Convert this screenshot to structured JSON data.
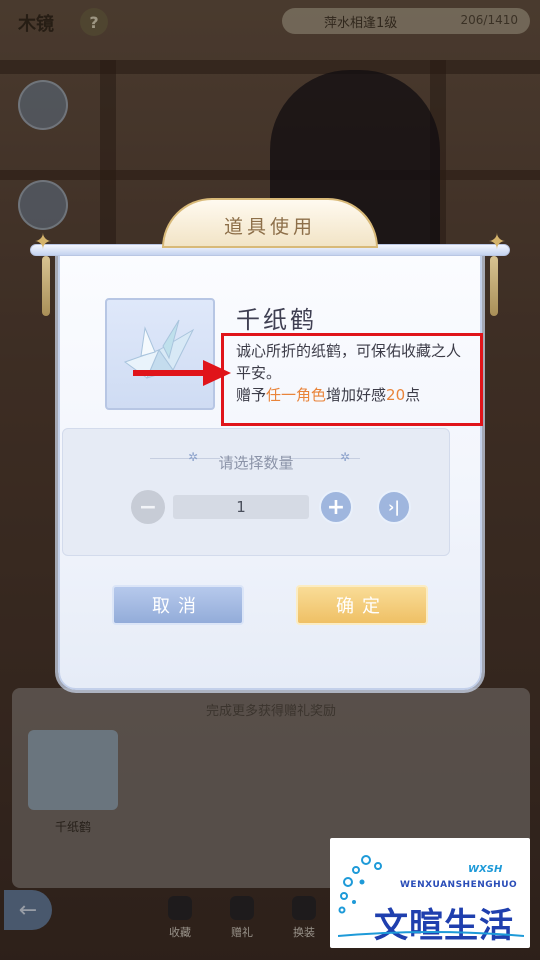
{
  "top_bar": {
    "title": "木镜",
    "help_label": "?",
    "level_label": "萍水相逢1级",
    "progress": "206/1410"
  },
  "modal": {
    "title": "道具使用",
    "item": {
      "name": "千纸鹤",
      "desc_line1": "诚心所折的纸鹤，可保佑收藏之人平安。",
      "desc_prefix": "赠予",
      "desc_target": "任一角色",
      "desc_mid": "增加好感",
      "desc_value": "20",
      "desc_suffix": "点"
    },
    "quantity": {
      "title": "请选择数量",
      "value": "1",
      "minus_label": "−",
      "plus_label": "+",
      "max_label": "›|"
    },
    "buttons": {
      "cancel": "取消",
      "confirm": "确定"
    }
  },
  "collection": {
    "caption": "完成更多获得赠礼奖励",
    "item_label": "千纸鹤"
  },
  "bottom_nav": {
    "items": [
      "收藏",
      "赠礼",
      "换装"
    ]
  },
  "watermark": {
    "pinyin": "WENXUANSHENGHUO",
    "small": "WXSH",
    "main": "文暄生活"
  },
  "colors": {
    "highlight": "#e9843a",
    "annotation_red": "#e0141a",
    "confirm": "#efc065",
    "cancel": "#93acd9"
  }
}
